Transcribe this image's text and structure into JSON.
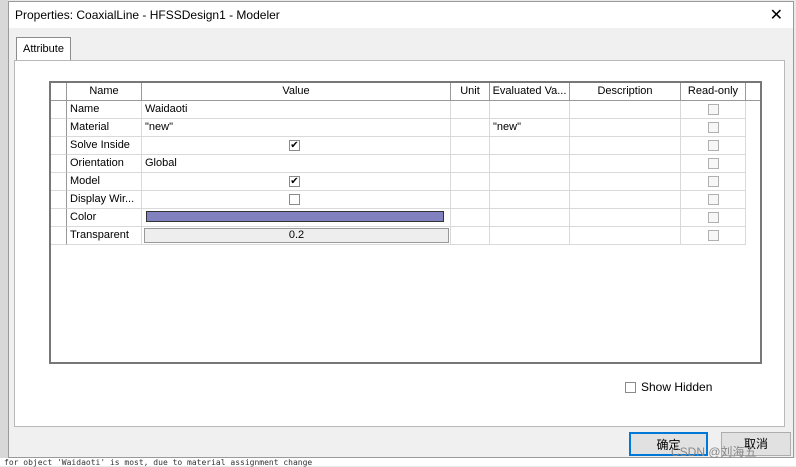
{
  "window": {
    "title": "Properties: CoaxialLine - HFSSDesign1 - Modeler"
  },
  "tabs": [
    {
      "label": "Attribute"
    }
  ],
  "columns": [
    "Name",
    "Value",
    "Unit",
    "Evaluated Va...",
    "Description",
    "Read-only"
  ],
  "rows": [
    {
      "name": "Name",
      "value": "Waidaoti",
      "evaluated": "",
      "checked": null
    },
    {
      "name": "Material",
      "value": "\"new\"",
      "evaluated": "\"new\"",
      "checked": null
    },
    {
      "name": "Solve Inside",
      "value": "",
      "evaluated": "",
      "checked": true
    },
    {
      "name": "Orientation",
      "value": "Global",
      "evaluated": "",
      "checked": null
    },
    {
      "name": "Model",
      "value": "",
      "evaluated": "",
      "checked": true
    },
    {
      "name": "Display Wir...",
      "value": "",
      "evaluated": "",
      "checked": false
    },
    {
      "name": "Color",
      "value": "",
      "evaluated": "",
      "checked": null
    },
    {
      "name": "Transparent",
      "value": "0.2",
      "evaluated": "",
      "checked": null
    }
  ],
  "colors": {
    "object_color": "#8181c0",
    "ok_border": "#0078d7"
  },
  "show_hidden": {
    "label": "Show Hidden",
    "checked": false
  },
  "buttons": {
    "ok": "确定",
    "cancel": "取消"
  },
  "watermark": "CSDN @刘海五",
  "background_text": "for object 'Waidaoti' is most, due to material assignment change"
}
